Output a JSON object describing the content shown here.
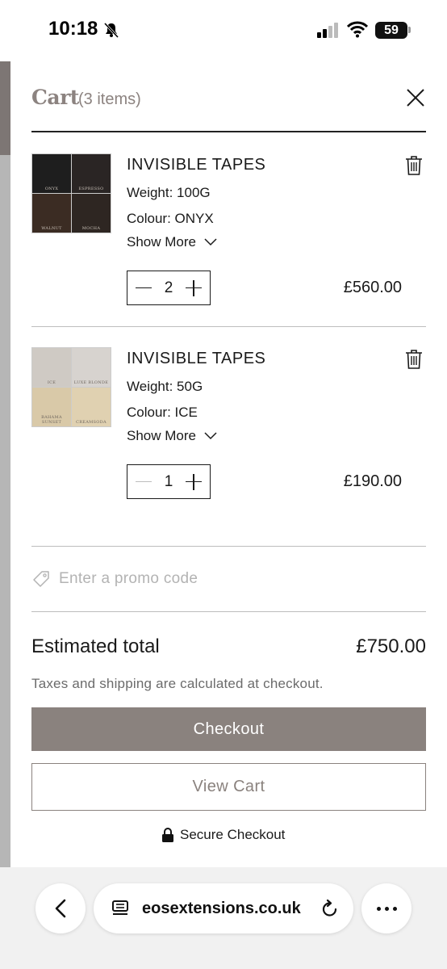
{
  "status_bar": {
    "time": "10:18",
    "battery": "59"
  },
  "cart": {
    "title": "Cart",
    "count": "(3 items)",
    "items": [
      {
        "name": "INVISIBLE TAPES",
        "weight": "Weight: 100G",
        "colour": "Colour: ONYX",
        "show_more": "Show More",
        "quantity": "2",
        "price": "£560.00",
        "thumb_labels": [
          "ONYX",
          "ESPRESSO",
          "WALNUT",
          "MOCHA"
        ]
      },
      {
        "name": "INVISIBLE TAPES",
        "weight": "Weight: 50G",
        "colour": "Colour: ICE",
        "show_more": "Show More",
        "quantity": "1",
        "price": "£190.00",
        "thumb_labels": [
          "ICE",
          "LUXE BLONDE",
          "BAHAMA SUNSET",
          "CREAMSODA"
        ]
      }
    ],
    "promo_placeholder": "Enter a promo code",
    "estimated_label": "Estimated total",
    "estimated_value": "£750.00",
    "tax_note": "Taxes and shipping are calculated at checkout.",
    "checkout_label": "Checkout",
    "view_cart_label": "View Cart",
    "secure_label": "Secure Checkout"
  },
  "browser": {
    "url": "eosextensions.co.uk"
  },
  "colors": {
    "accent": "#8a827e",
    "title": "#8c8380",
    "divider": "#bdbdbd"
  }
}
